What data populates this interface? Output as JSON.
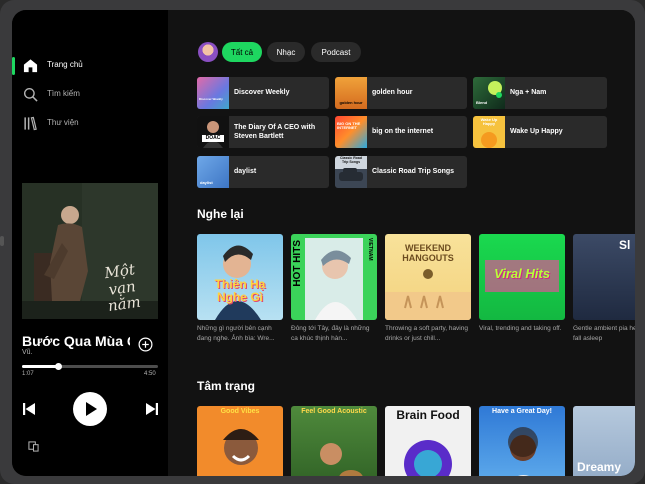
{
  "sidebar": {
    "nav": [
      {
        "label": "Trang chủ",
        "icon": "home-icon",
        "active": true
      },
      {
        "label": "Tìm kiếm",
        "icon": "search-icon",
        "active": false
      },
      {
        "label": "Thư viện",
        "icon": "library-icon",
        "active": false
      }
    ],
    "now_playing": {
      "title": "Bước Qua Mùa Cô Đơn",
      "artist": "Vũ.",
      "cover_script": "Một vạn năm",
      "elapsed": "1:07",
      "duration": "4:50",
      "progress": 0.27
    }
  },
  "filters": [
    "Tất cả",
    "Nhạc",
    "Podcast"
  ],
  "quick": [
    {
      "label": "Discover Weekly",
      "art_text": "Discover Weekly"
    },
    {
      "label": "golden hour",
      "art_text": "golden hour"
    },
    {
      "label": "Nga + Nam",
      "art_text": "Blend"
    },
    {
      "label": "The Diary Of A CEO with Steven Bartlett",
      "art_text": "DOAC"
    },
    {
      "label": "big on the internet",
      "art_text": "BIG ON THE INTERNET"
    },
    {
      "label": "Wake Up Happy",
      "art_text": "Wake Up Happy"
    },
    {
      "label": "daylist",
      "art_text": "daylist"
    },
    {
      "label": "Classic Road Trip Songs",
      "art_text": "Classic Road Trip Songs"
    }
  ],
  "sections": {
    "replay": {
      "title": "Nghe lại",
      "cards": [
        {
          "cover": "Thiên Hạ Nghe Gì",
          "desc": "Những gì người bên cạnh đang nghe. Ảnh bìa: Wre..."
        },
        {
          "cover": "HOT HITS",
          "cover_side": "VIETNAM",
          "desc": "Đông tới Tây, đây là những ca khúc thịnh hàn..."
        },
        {
          "cover": "WEEKEND HANGOUTS",
          "desc": "Throwing a soft party, having drinks or just chill..."
        },
        {
          "cover": "Viral Hits",
          "desc": "Viral, trending and taking off."
        },
        {
          "cover": "Sl",
          "desc": "Gentle ambient pia help you fall asleep"
        }
      ]
    },
    "mood": {
      "title": "Tâm trạng",
      "cards": [
        {
          "cover": "Good Vibes"
        },
        {
          "cover": "Feel Good Acoustic"
        },
        {
          "cover": "Brain Food"
        },
        {
          "cover": "Have a Great Day!"
        },
        {
          "cover": "Dreamy"
        }
      ]
    }
  },
  "colors": {
    "accent": "#1ed760",
    "background": "#121212",
    "sidebar": "#000000",
    "tile": "#2a2a2a"
  }
}
